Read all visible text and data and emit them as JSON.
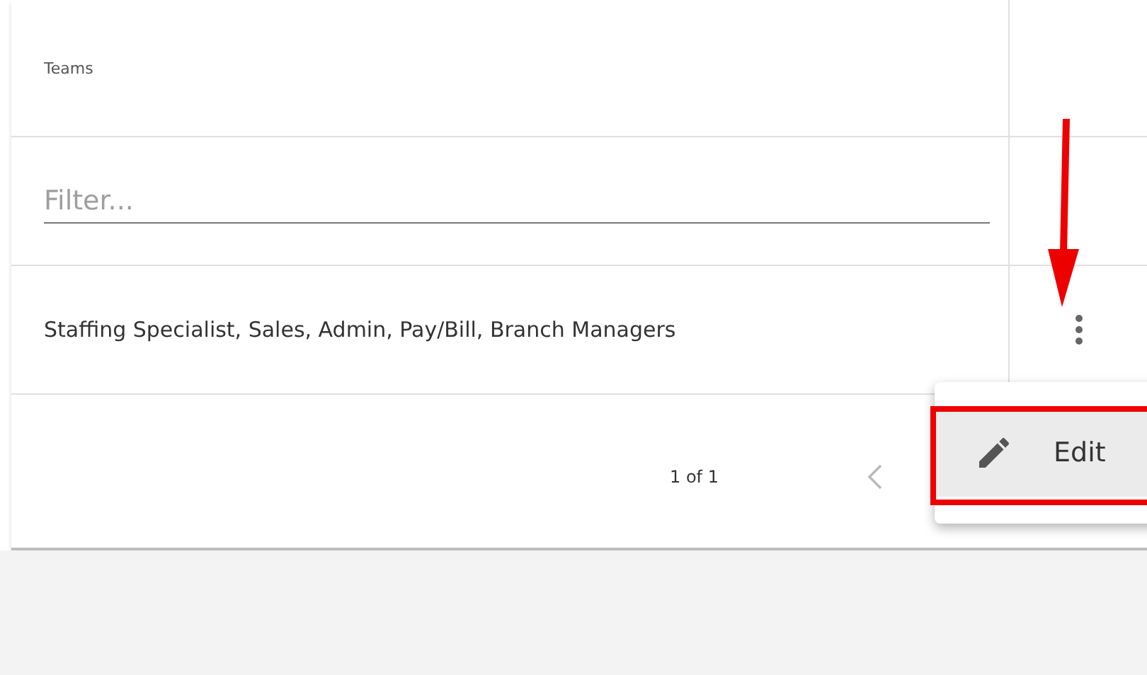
{
  "table": {
    "column_header": "Teams",
    "filter": {
      "placeholder": "Filter..."
    },
    "rows": [
      {
        "teams": "Staffing Specialist, Sales, Admin, Pay/Bill, Branch Managers"
      }
    ],
    "pagination": {
      "page_info": "1 of 1"
    }
  },
  "row_menu": {
    "items": [
      {
        "label": "Edit",
        "selected": true
      }
    ]
  }
}
